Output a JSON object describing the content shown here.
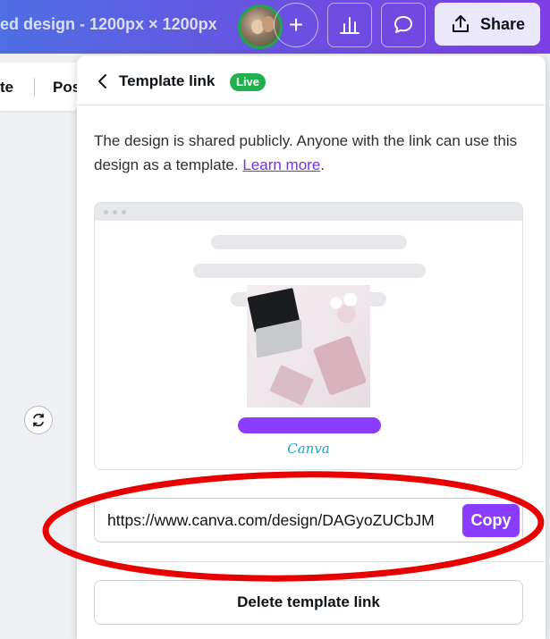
{
  "header": {
    "design_title": "ed design - 1200px × 1200px",
    "add_label": "+",
    "share_label": "Share"
  },
  "toolbar": {
    "item1": "te",
    "item2": "Pos"
  },
  "panel": {
    "title": "Template link",
    "badge": "Live",
    "description": "The design is shared publicly. Anyone with the link can use this design as a template.",
    "learn_more": "Learn more",
    "preview_logo": "Canva",
    "link_value": "https://www.canva.com/design/DAGyoZUCbJM",
    "copy_label": "Copy",
    "delete_label": "Delete template link"
  },
  "colors": {
    "accent": "#8b3dff",
    "live": "#22b04f",
    "annotation": "#e80000"
  },
  "icons": {
    "back": "chevron-left-icon",
    "insights": "bar-chart-icon",
    "comment": "speech-bubble-icon",
    "share": "upload-icon",
    "rotate": "rotate-icon"
  }
}
